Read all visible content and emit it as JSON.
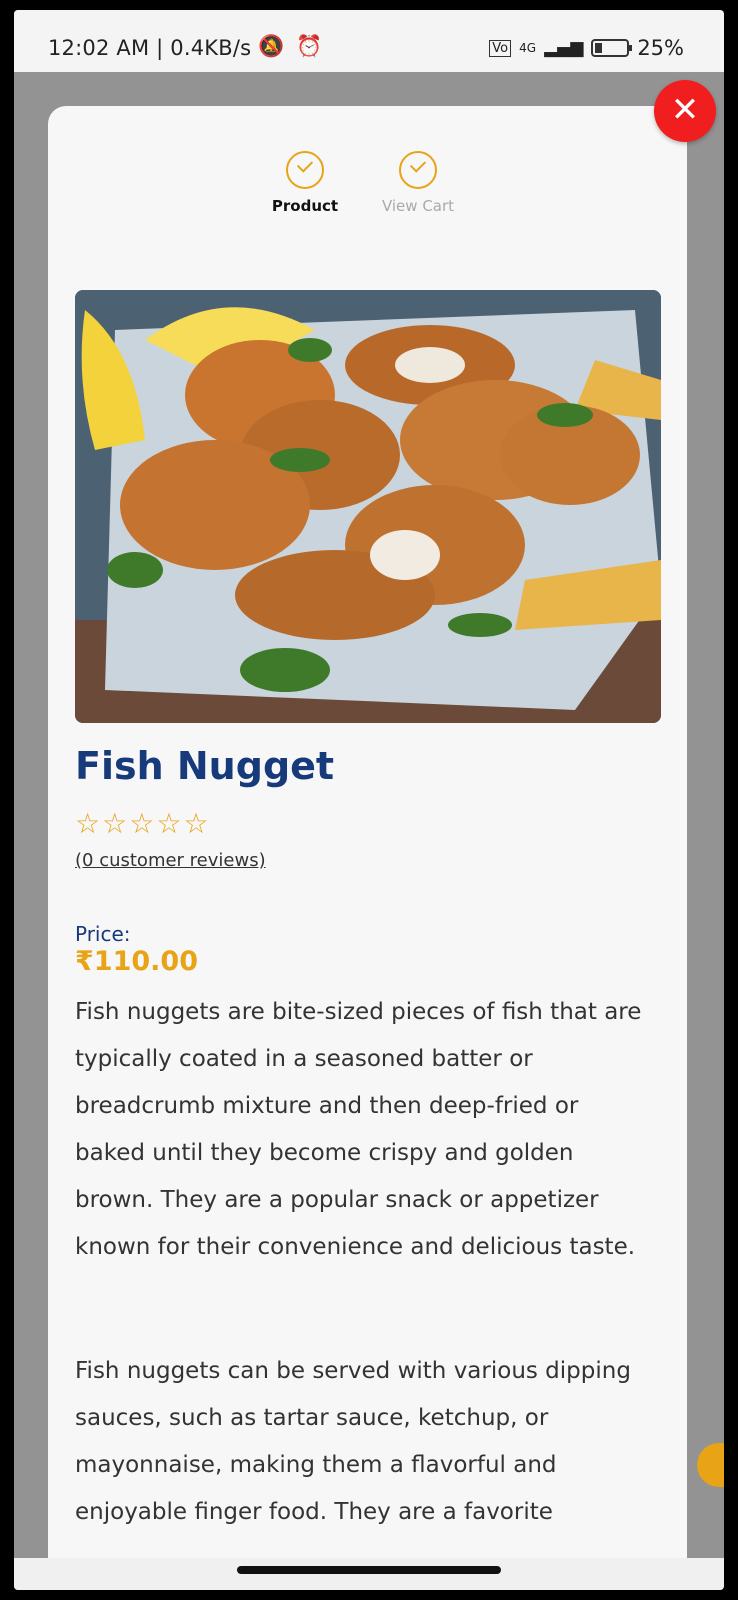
{
  "status_bar": {
    "time_speed": "12:02 AM | 0.4KB/s",
    "network": "4G",
    "battery": "25%"
  },
  "stepper": {
    "steps": [
      {
        "label": "Product",
        "state": "active"
      },
      {
        "label": "View Cart",
        "state": "inactive"
      }
    ]
  },
  "product": {
    "name": "Fish Nugget",
    "rating_stars": 0,
    "reviews_text": "(0 customer reviews)",
    "price_label": "Price:",
    "price": "₹110.00",
    "description": [
      "Fish nuggets are bite-sized pieces of fish that are typically coated in a seasoned batter or breadcrumb mixture and then deep-fried or baked until they become crispy and golden brown. They are a popular snack or appetizer known for their convenience and delicious taste.",
      "Fish nuggets can be served with various dipping sauces, such as tartar sauce, ketchup, or mayonnaise, making them a flavorful and enjoyable finger food. They are a favorite"
    ]
  },
  "icons": {
    "close": "close-icon",
    "step_check": "check-circle-icon",
    "star": "star-outline-icon"
  },
  "colors": {
    "accent": "#e8a317",
    "title": "#163a7a",
    "close_bg": "#f01e1e"
  }
}
